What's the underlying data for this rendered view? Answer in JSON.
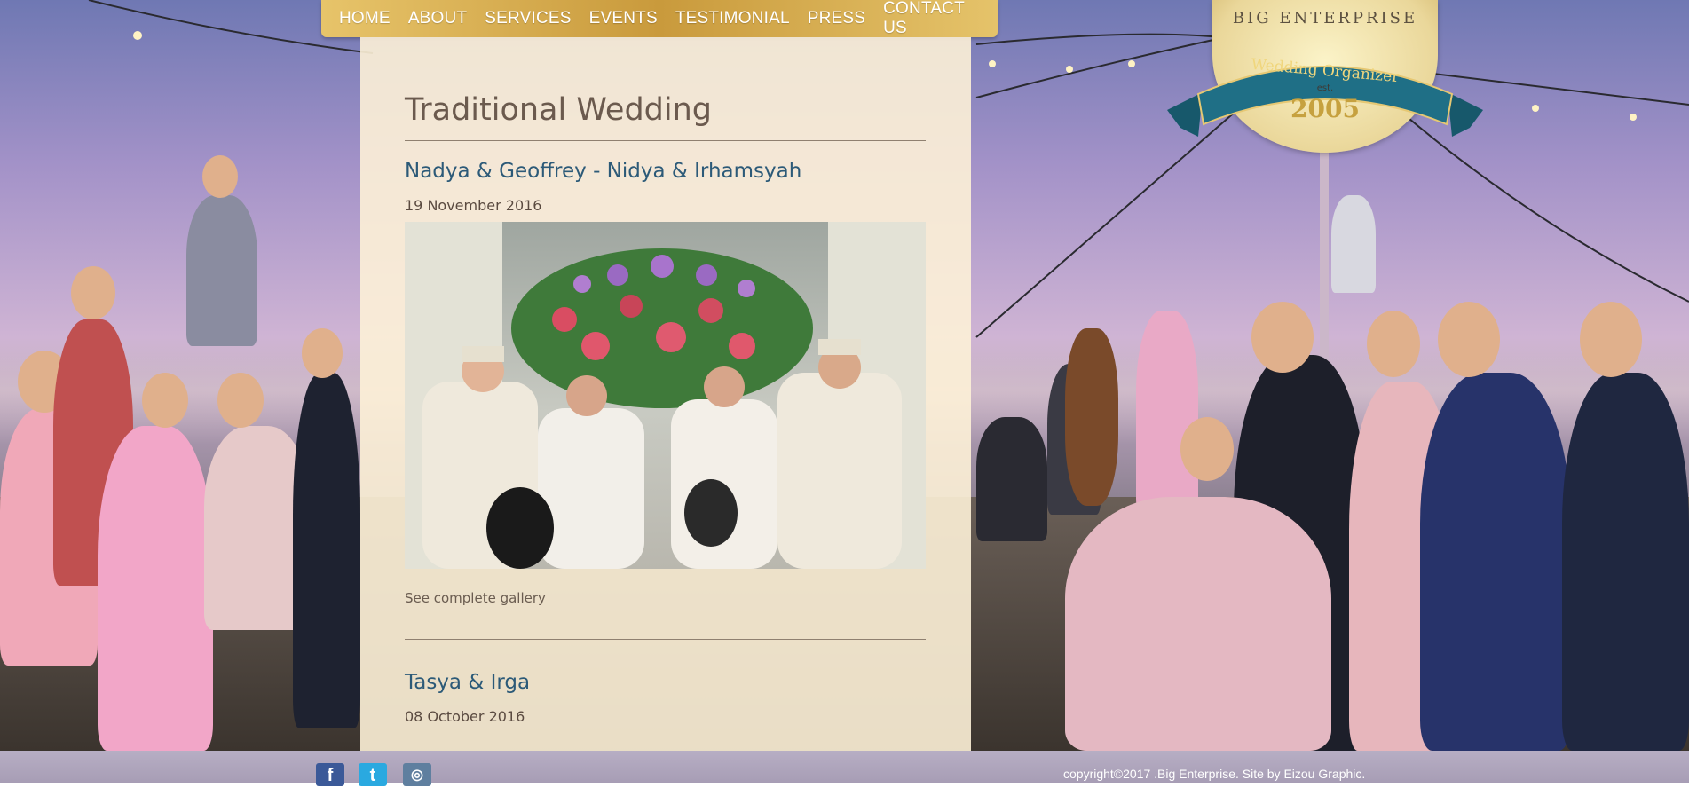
{
  "nav": {
    "items": [
      {
        "label": "HOME"
      },
      {
        "label": "ABOUT"
      },
      {
        "label": "SERVICES"
      },
      {
        "label": "EVENTS"
      },
      {
        "label": "TESTIMONIAL"
      },
      {
        "label": "PRESS"
      },
      {
        "label": "CONTACT US"
      }
    ]
  },
  "logo": {
    "name": "BIG ENTERPRISE",
    "tagline": "Wedding Organizer",
    "est": "est.",
    "year": "2005"
  },
  "main": {
    "title": "Traditional Wedding",
    "posts": [
      {
        "title": "Nadya & Geoffrey - Nidya & Irhamsyah",
        "date": "19 November 2016",
        "link": "See complete gallery"
      },
      {
        "title": "Tasya & Irga",
        "date": "08 October 2016"
      }
    ]
  },
  "footer": {
    "social": [
      {
        "icon": "facebook-icon",
        "glyph": "f",
        "color": "#3b5998"
      },
      {
        "icon": "twitter-icon",
        "glyph": "t",
        "color": "#2aa9e0"
      },
      {
        "icon": "instagram-icon",
        "glyph": "◎",
        "color": "#5f7f9f"
      }
    ],
    "copyright": "copyright©2017 .Big Enterprise. Site by Eizou Graphic."
  },
  "colors": {
    "nav_gold": "#d4a94d",
    "title_brown": "#6b5a4e",
    "post_blue": "#2c5a78",
    "ribbon_teal": "#1f6f86"
  }
}
